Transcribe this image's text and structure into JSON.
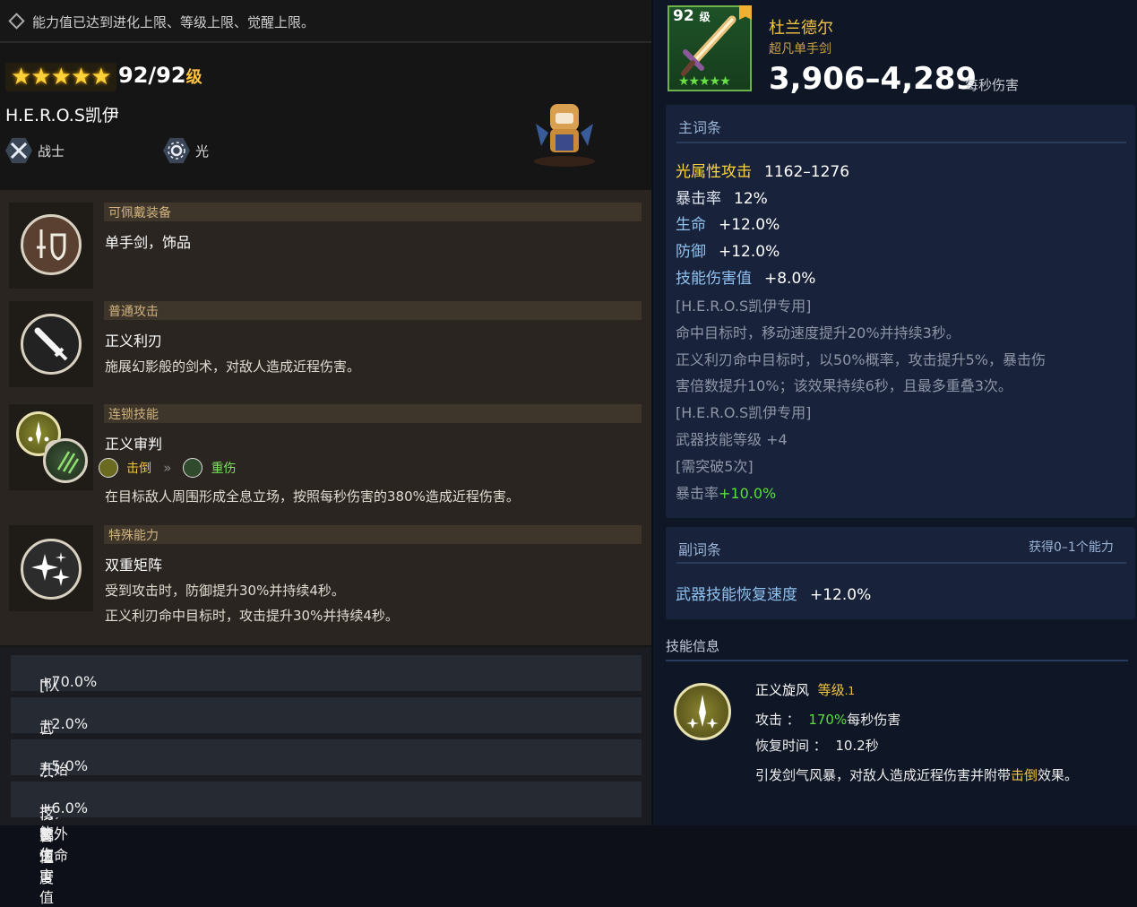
{
  "notice": "能力值已达到进化上限、等级上限、觉醒上限。",
  "hero": {
    "stars": "★★★★★",
    "level": "92/92",
    "level_unit": "级",
    "name": "H.E.R.O.S凯伊",
    "role1": "战士",
    "role2": "光"
  },
  "skills": [
    {
      "caption": "可佩戴装备",
      "title": "单手剑，饰品",
      "desc": [],
      "icon": "sword-shield-icon"
    },
    {
      "caption": "普通攻击",
      "title": "正义利刃",
      "desc": [
        "施展幻影般的剑术，对敌人造成近程伤害。"
      ],
      "icon": "sword-icon"
    },
    {
      "caption": "连锁技能",
      "title": "正义审判",
      "chain_from": "击倒",
      "chain_to": "重伤",
      "desc": [
        "在目标敌人周围形成全息立场，按照每秒伤害的380%造成近程伤害。"
      ],
      "icon": "chain-icon"
    },
    {
      "caption": "特殊能力",
      "title": "双重矩阵",
      "desc": [
        "受到攻击时，防御提升30%并持续4秒。",
        "正义利刃命中目标时，攻击提升30%并持续4秒。"
      ],
      "icon": "sparkle-icon"
    }
  ],
  "bonuses": [
    {
      "label": "[队伍]普通攻击伤害值",
      "value": "+70.0%"
    },
    {
      "label": "武器技能恢复速度",
      "value": "+2.0%"
    },
    {
      "label": "开始战斗时，额外生命",
      "value": "+5.0%"
    },
    {
      "label": "技能伤害值",
      "value": "+6.0%"
    }
  ],
  "weapon": {
    "level": "92",
    "level_unit": "级",
    "stars": "★★★★★",
    "name": "杜兰德尔",
    "type": "超凡单手剑",
    "dps": "3,906–4,289",
    "dps_label": "每秒伤害"
  },
  "main_stats": {
    "header": "主词条",
    "stats": [
      {
        "key": "光属性攻击",
        "value": "1162–1276",
        "color": "#ffd43b"
      },
      {
        "key": "暴击率",
        "value": "12%",
        "color": "#dfe6f0"
      },
      {
        "key": "生命",
        "value": "+12.0%",
        "color": "#8fc2f0"
      },
      {
        "key": "防御",
        "value": "+12.0%",
        "color": "#8fc2f0"
      },
      {
        "key": "技能伤害值",
        "value": "+8.0%",
        "color": "#8fc2f0"
      }
    ],
    "notes": [
      "[H.E.R.O.S凯伊专用]",
      "命中目标时，移动速度提升20%并持续3秒。",
      "正义利刃命中目标时，以50%概率，攻击提升5%，暴击伤",
      "害倍数提升10%；该效果持续6秒，且最多重叠3次。",
      "[H.E.R.O.S凯伊专用]",
      "武器技能等级 +4",
      "[需突破5次]"
    ],
    "last_key": "暴击率",
    "last_value": "+10.0%"
  },
  "sub_stats": {
    "header": "副词条",
    "right": "获得0–1个能力",
    "key": "武器技能恢复速度",
    "value": "+12.0%"
  },
  "skill_info": {
    "header": "技能信息",
    "name": "正义旋风",
    "level_label": "等级",
    "level": ".1",
    "attack_label": "攻击 ：",
    "attack_value": "170%",
    "attack_unit": "每秒伤害",
    "cooldown_label": "恢复时间 ：",
    "cooldown_value": "10.2秒",
    "desc_a": "引发剑气风暴，对敌人造成近程伤害并附带",
    "desc_kw": "击倒",
    "desc_b": "效果。"
  },
  "colors": {
    "gold": "#f0c440",
    "green": "#55e03a",
    "blue": "#8fc2f0"
  }
}
